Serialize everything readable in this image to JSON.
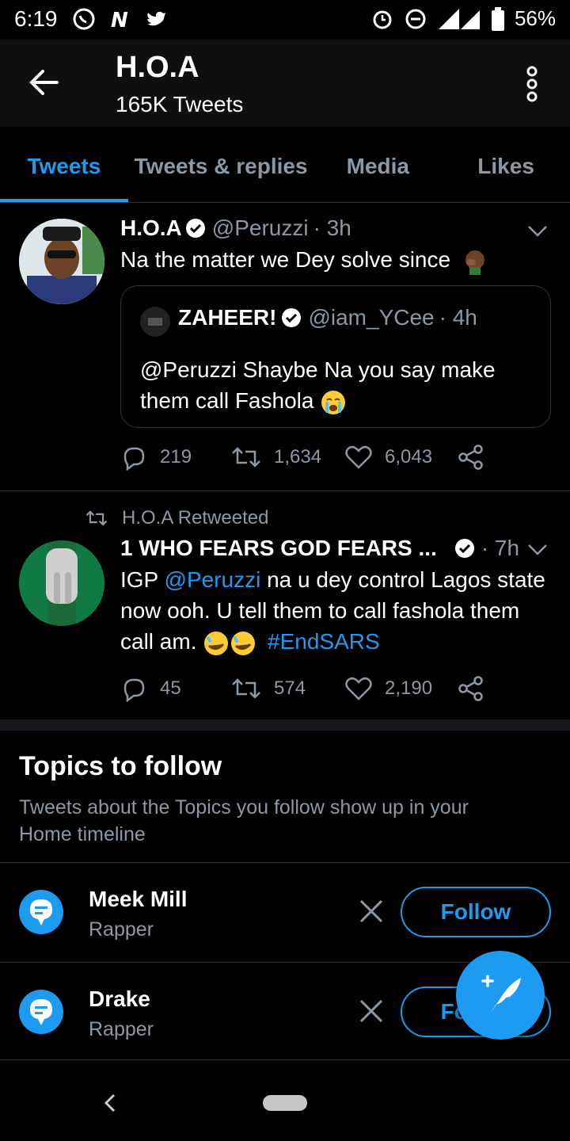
{
  "status_bar": {
    "time": "6:19",
    "battery": "56%",
    "network": "3G"
  },
  "header": {
    "title": "H.O.A",
    "subtitle": "165K Tweets"
  },
  "tabs": [
    {
      "label": "Tweets",
      "active": true
    },
    {
      "label": "Tweets & replies",
      "active": false
    },
    {
      "label": "Media",
      "active": false
    },
    {
      "label": "Likes",
      "active": false
    }
  ],
  "tweet1": {
    "name": "H.O.A",
    "handle": "@Peruzzi",
    "time": "· 3h",
    "text": "Na the matter we Dey solve since",
    "quote": {
      "name": "ZAHEER!",
      "handle": "@iam_YCee",
      "time": "· 4h",
      "text": "@Peruzzi Shaybe Na you say make them call Fashola"
    },
    "replies": "219",
    "retweets": "1,634",
    "likes": "6,043"
  },
  "tweet2": {
    "retweet_label": "H.O.A Retweeted",
    "name": "1 WHO FEARS GOD FEARS ...",
    "time": "· 7h",
    "text_prefix": "IGP ",
    "mention": "@Peruzzi",
    "text_body": " na u dey control Lagos state now ooh. U tell them to call fashola them call am.",
    "hashtag": "#EndSARS",
    "replies": "45",
    "retweets": "574",
    "likes": "2,190"
  },
  "topics": {
    "title": "Topics to follow",
    "description": "Tweets about the Topics you follow show up in your Home timeline",
    "items": [
      {
        "name": "Meek Mill",
        "category": "Rapper",
        "button": "Follow"
      },
      {
        "name": "Drake",
        "category": "Rapper",
        "button": "Follow"
      }
    ]
  },
  "colors": {
    "accent": "#1d9bf0",
    "background": "#000000",
    "secondary_text": "#8b98a5"
  }
}
